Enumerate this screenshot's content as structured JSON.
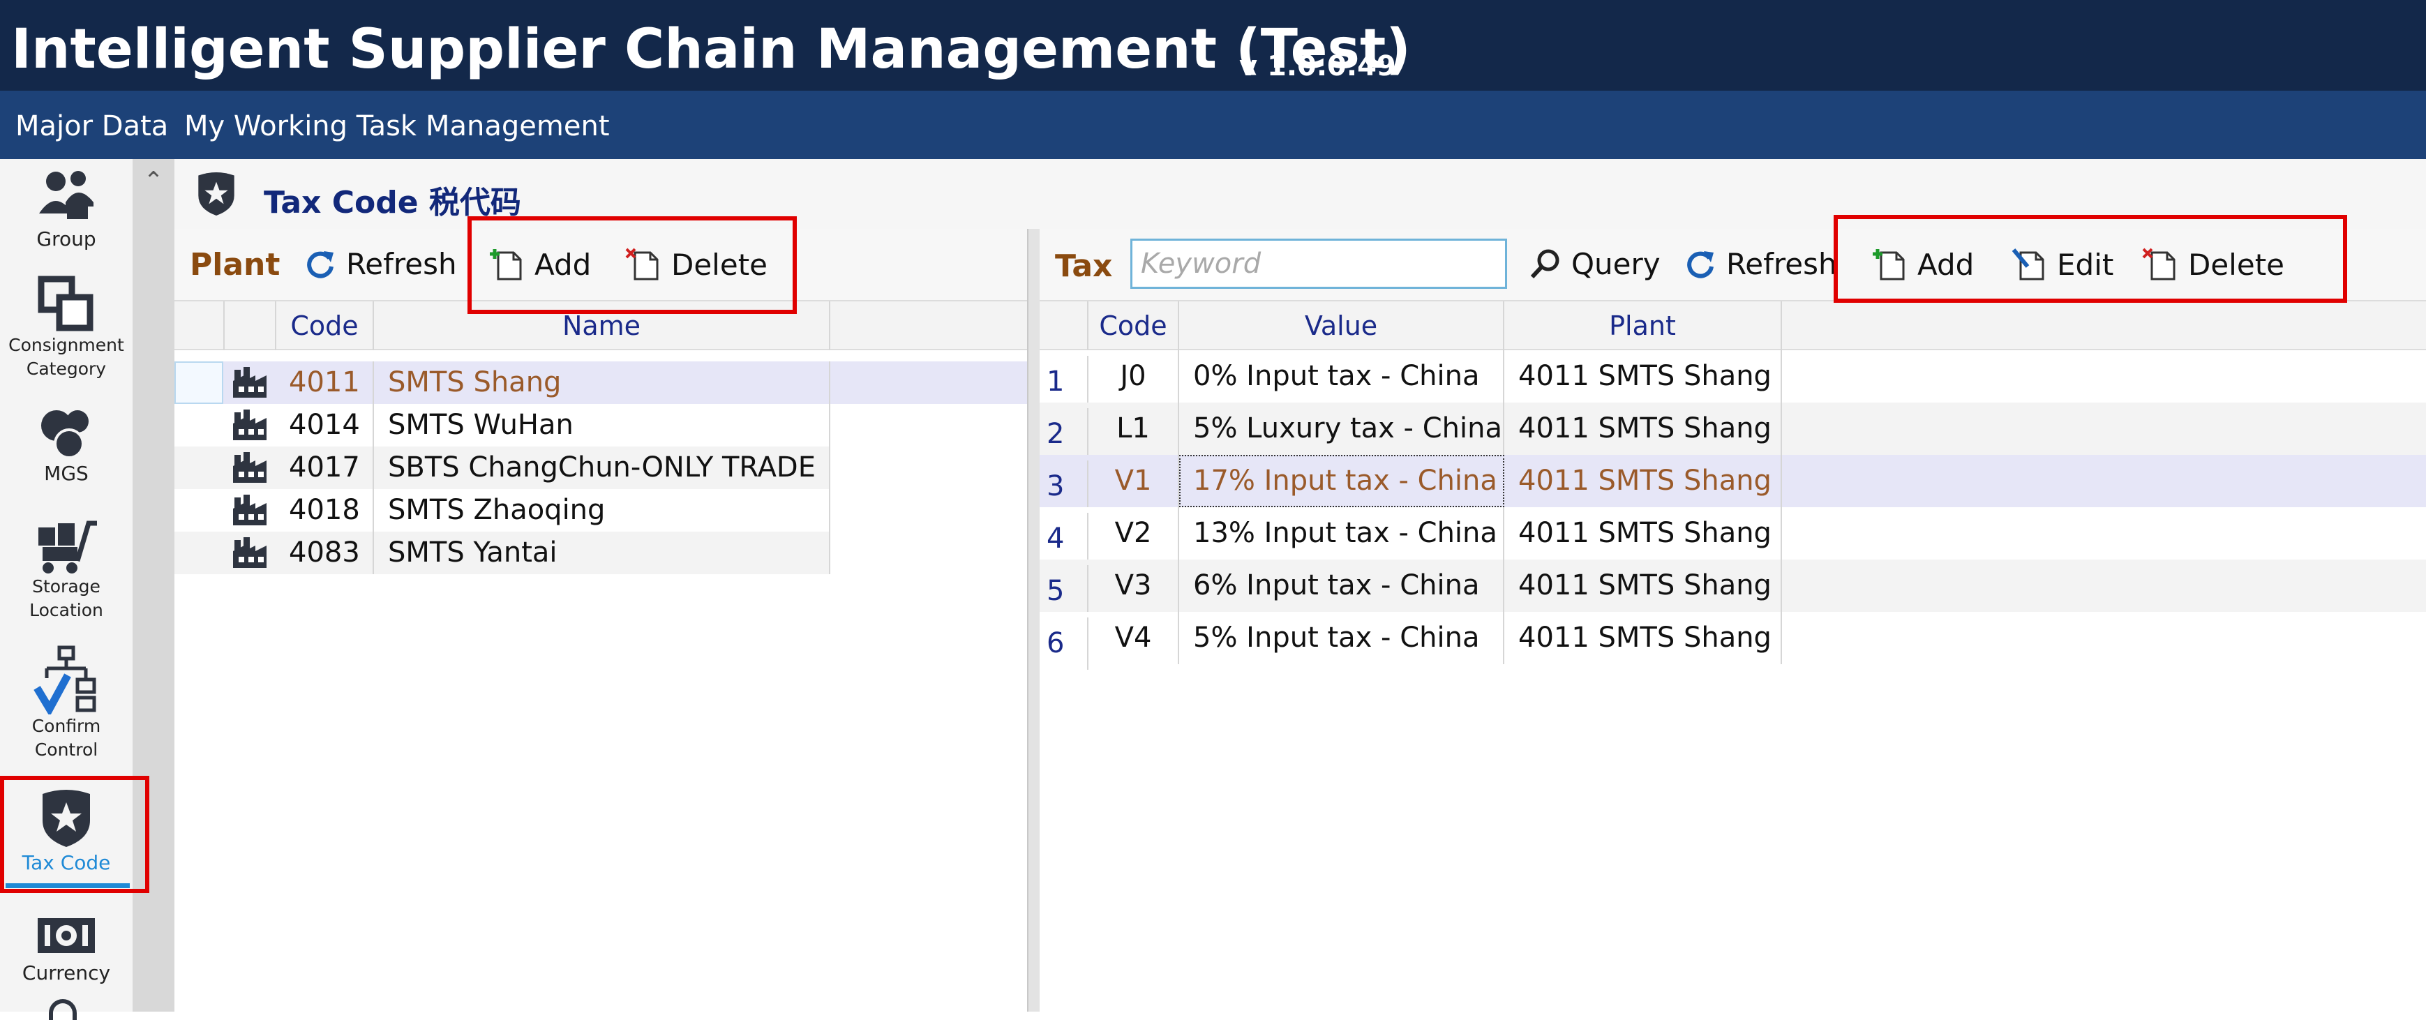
{
  "app": {
    "title": "Intelligent Supplier Chain Management (Test)",
    "version": "v 1.0.0.49"
  },
  "menu": {
    "items": [
      "Major Data",
      "My Working Task",
      "Management"
    ]
  },
  "nav": {
    "items": [
      {
        "label": "Group",
        "icon": "group-icon"
      },
      {
        "label": "Consignment Category",
        "icon": "consignment-category-icon"
      },
      {
        "label": "MGS",
        "icon": "mgs-icon"
      },
      {
        "label": "Storage Location",
        "icon": "storage-location-icon"
      },
      {
        "label": "Confirm Control",
        "icon": "confirm-control-icon"
      },
      {
        "label": "Tax Code",
        "icon": "tax-code-icon",
        "active": true
      },
      {
        "label": "Currency",
        "icon": "currency-icon"
      }
    ],
    "active_color": "#1f8ad6"
  },
  "module": {
    "title": "Tax Code 税代码",
    "icon": "tax-code-shield-icon"
  },
  "plant": {
    "label": "Plant",
    "toolbar": {
      "refresh": "Refresh",
      "add": "Add",
      "delete": "Delete"
    },
    "columns": {
      "code": "Code",
      "name": "Name"
    },
    "rows": [
      {
        "code": "4011",
        "name": "SMTS Shang",
        "selected": true
      },
      {
        "code": "4014",
        "name": "SMTS WuHan"
      },
      {
        "code": "4017",
        "name": "SBTS ChangChun-ONLY TRADE"
      },
      {
        "code": "4018",
        "name": "SMTS Zhaoqing"
      },
      {
        "code": "4083",
        "name": "SMTS Yantai"
      }
    ]
  },
  "tax": {
    "label": "Tax",
    "search": {
      "placeholder": "Keyword",
      "value": ""
    },
    "toolbar": {
      "query": "Query",
      "refresh": "Refresh",
      "add": "Add",
      "edit": "Edit",
      "delete": "Delete"
    },
    "columns": {
      "code": "Code",
      "value": "Value",
      "plant": "Plant"
    },
    "rows": [
      {
        "num": "1",
        "code": "J0",
        "value": "0% Input tax - China",
        "plant": "4011 SMTS Shang"
      },
      {
        "num": "2",
        "code": "L1",
        "value": "5% Luxury tax - China",
        "plant": "4011 SMTS Shang"
      },
      {
        "num": "3",
        "code": "V1",
        "value": "17% Input tax - China",
        "plant": "4011 SMTS Shang",
        "selected": true
      },
      {
        "num": "4",
        "code": "V2",
        "value": "13% Input tax - China",
        "plant": "4011 SMTS Shang"
      },
      {
        "num": "5",
        "code": "V3",
        "value": "6% Input tax - China",
        "plant": "4011 SMTS Shang"
      },
      {
        "num": "6",
        "code": "V4",
        "value": "5% Input tax - China",
        "plant": "4011 SMTS Shang"
      }
    ]
  },
  "colors": {
    "title_bar": "#13284a",
    "menu_bar": "#1d4278",
    "selected_row": "#e6e6f7",
    "selected_text": "#9a5a2a",
    "highlight_box": "#e00000"
  }
}
